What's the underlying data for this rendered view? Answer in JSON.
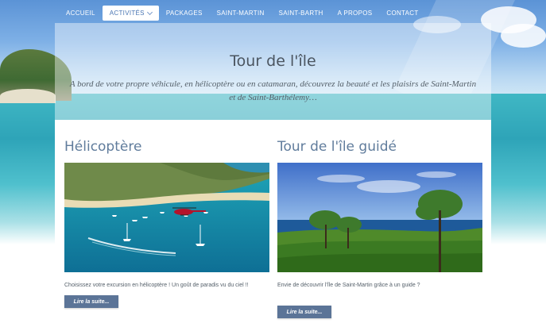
{
  "nav": {
    "items": [
      {
        "label": "ACCUEIL",
        "active": false
      },
      {
        "label": "ACTIVITÉS",
        "active": true,
        "has_dropdown": true
      },
      {
        "label": "PACKAGES",
        "active": false
      },
      {
        "label": "SAINT-MARTIN",
        "active": false
      },
      {
        "label": "SAINT-BARTH",
        "active": false
      },
      {
        "label": "A PROPOS",
        "active": false
      },
      {
        "label": "CONTACT",
        "active": false
      }
    ]
  },
  "hero": {
    "title": "Tour de l'île",
    "subtitle": "A bord de votre propre véhicule, en hélicoptère ou en catamaran, découvrez la beauté et les plaisirs de Saint-Martin et de Saint-Barthélemy…"
  },
  "cards": [
    {
      "title": "Hélicoptère",
      "image": "helicopter-over-bay-with-sailboats",
      "text": "Choisissez votre excursion en hélicoptère ! Un goût de paradis vu du ciel !!",
      "button": "Lire la suite..."
    },
    {
      "title": "Tour de l'île guidé",
      "image": "green-hills-trees-ocean-view",
      "text": "Envie de découvrir l'île de Saint-Martin grâce à un guide ?",
      "button": "Lire la suite..."
    }
  ],
  "colors": {
    "nav_active_text": "#4a76b3",
    "card_title": "#607c9c",
    "button_bg": "#5b7497"
  }
}
